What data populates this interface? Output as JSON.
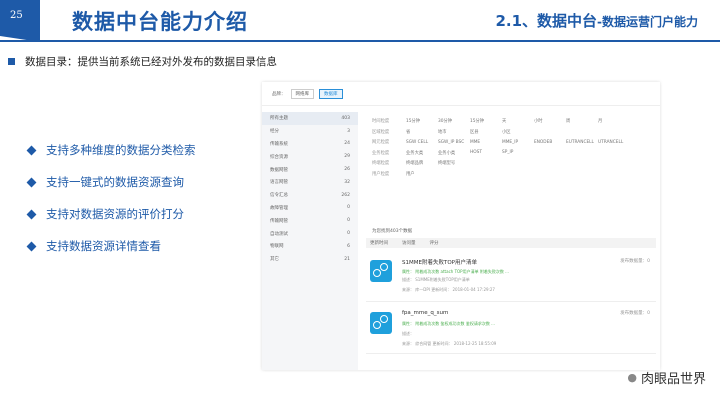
{
  "header": {
    "page_number": "25",
    "title": "数据中台能力介绍",
    "subtitle_main": "2.1、数据中台",
    "subtitle_small": "-数据运营门户能力"
  },
  "intro": "数据目录：提供当前系统已经对外发布的数据目录信息",
  "features": [
    "支持多种维度的数据分类检索",
    "支持一键式的数据资源查询",
    "支持对数据资源的评价打分",
    "支持数据资源详情查看"
  ],
  "screenshot": {
    "topbar": {
      "label": "品牌：",
      "tab1": "网络库",
      "tab2": "数据库"
    },
    "sidebar": [
      {
        "label": "所有主题",
        "count": "403"
      },
      {
        "label": "经分",
        "count": "3"
      },
      {
        "label": "传输系统",
        "count": "24"
      },
      {
        "label": "综合资源",
        "count": "29"
      },
      {
        "label": "数据网管",
        "count": "26"
      },
      {
        "label": "语言网管",
        "count": "32"
      },
      {
        "label": "信令汇总",
        "count": "262"
      },
      {
        "label": "故障管理",
        "count": "0"
      },
      {
        "label": "传输网管",
        "count": "0"
      },
      {
        "label": "自动测试",
        "count": "0"
      },
      {
        "label": "物联网",
        "count": "6"
      },
      {
        "label": "其它",
        "count": "21"
      }
    ],
    "filters": [
      {
        "label": "时间粒度",
        "values": [
          "15分钟",
          "30分钟",
          "15分钟",
          "天",
          "小时",
          "周",
          "月"
        ]
      },
      {
        "label": "区域粒度",
        "values": [
          "省",
          "地市",
          "区县",
          "小区"
        ]
      },
      {
        "label": "网元粒度",
        "values": [
          "SGW CELL",
          "SGW_IP BSC",
          "MME",
          "MME_IP",
          "ENODEB",
          "EUTRANCELL",
          "UTRANCELL"
        ]
      },
      {
        "label": "业务粒度",
        "values": [
          "业务大类",
          "业务小类",
          "HOST",
          "SP_IP"
        ]
      },
      {
        "label": "终端粒度",
        "values": [
          "终端品牌",
          "终端型号"
        ]
      },
      {
        "label": "用户粒度",
        "values": [
          "用户"
        ]
      }
    ],
    "result_count": "为您找到403个数据",
    "sort": [
      "更新时间",
      "访问量",
      "评分"
    ],
    "results": [
      {
        "title": "S1MME附着失败TOP用户清单",
        "meta": "发布数据量：0",
        "tags": "属性：  附着成功次数  attach TOP用户清单  附着失败次数  ...",
        "desc": "描述：  S1MME附着失败TOP用户清单",
        "foot": "来源：  库—DPI          更新时间：  2018-01-04 17:29:27"
      },
      {
        "title": "fpa_mme_q_sum",
        "meta": "发布数据量：0",
        "tags": "属性：  附着成功次数  鉴权成功次数  鉴权请求次数  ...",
        "desc": "描述：",
        "foot": "来源：  综合网管          更新时间：  2018-12-25 18:55:09"
      }
    ]
  },
  "watermark": "肉眼品世界"
}
